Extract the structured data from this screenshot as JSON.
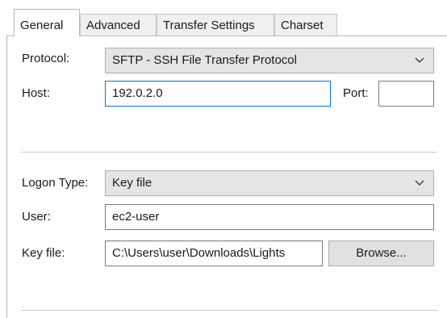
{
  "tabs": [
    {
      "label": "General",
      "active": true
    },
    {
      "label": "Advanced",
      "active": false
    },
    {
      "label": "Transfer Settings",
      "active": false
    },
    {
      "label": "Charset",
      "active": false
    }
  ],
  "general": {
    "protocol_label": "Protocol:",
    "protocol_value": "SFTP - SSH File Transfer Protocol",
    "host_label": "Host:",
    "host_value": "192.0.2.0",
    "port_label": "Port:",
    "port_value": "",
    "logon_type_label": "Logon Type:",
    "logon_type_value": "Key file",
    "user_label": "User:",
    "user_value": "ec2-user",
    "key_file_label": "Key file:",
    "key_file_value": "C:\\Users\\user\\Downloads\\Lights",
    "browse_label": "Browse..."
  },
  "icons": {
    "dropdown": "chevron-down-icon"
  },
  "colors": {
    "focus_border": "#0078d7",
    "combo_bg": "#e5e5e5"
  }
}
